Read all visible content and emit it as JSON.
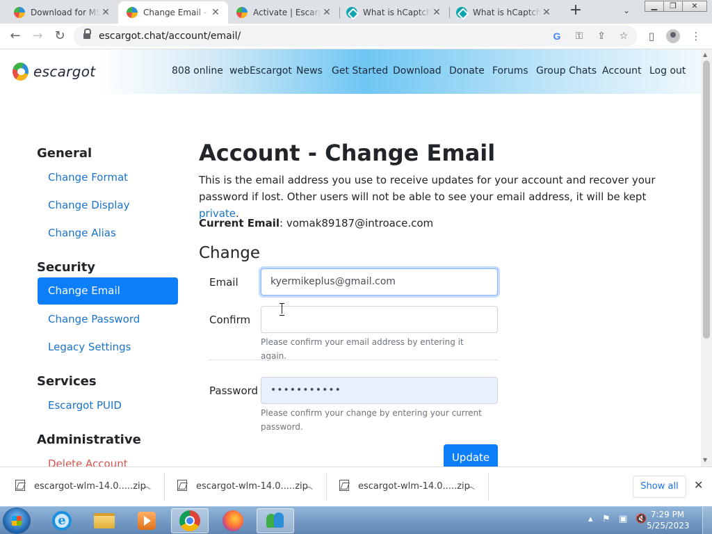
{
  "browser": {
    "tabs": [
      {
        "title": "Download for MSN",
        "active": false,
        "icon": "escargot-icon"
      },
      {
        "title": "Change Email - Acc",
        "active": true,
        "icon": "escargot-icon"
      },
      {
        "title": "Activate | Escargot",
        "active": false,
        "icon": "escargot-icon"
      },
      {
        "title": "What is hCaptcha",
        "active": false,
        "icon": "hcaptcha-icon"
      },
      {
        "title": "What is hCaptcha",
        "active": false,
        "icon": "hcaptcha-icon"
      }
    ],
    "url": "escargot.chat/account/email/"
  },
  "site": {
    "logo_text": "escargot",
    "nav": [
      "808 online",
      "webEscargot",
      "News",
      "Get Started",
      "Download",
      "Donate",
      "Forums",
      "Group Chats",
      "Account",
      "Log out"
    ]
  },
  "sidebar": {
    "sections": [
      {
        "heading": "General",
        "items": [
          "Change Format",
          "Change Display",
          "Change Alias"
        ]
      },
      {
        "heading": "Security",
        "items": [
          "Change Email",
          "Change Password",
          "Legacy Settings"
        ]
      },
      {
        "heading": "Services",
        "items": [
          "Escargot PUID"
        ]
      },
      {
        "heading": "Administrative",
        "items": [
          "Delete Account"
        ]
      }
    ],
    "active_item": "Change Email"
  },
  "main": {
    "title": "Account - Change Email",
    "description": "This is the email address you use to receive updates for your account and recover your password if lost. Other users will not be able to see your email address, it will be kept",
    "description_link": "private",
    "current_email_label": "Current Email",
    "current_email_value": "vomak89187@introace.com",
    "change_heading": "Change",
    "form": {
      "email_label": "Email",
      "email_value": "kyermikeplus@gmail.com",
      "confirm_label": "Confirm",
      "confirm_value": "",
      "confirm_hint": "Please confirm your email address by entering it again.",
      "password_label": "Password",
      "password_value": "•••••••••••",
      "password_hint": "Please confirm your change by entering your current password.",
      "submit_label": "Update"
    }
  },
  "downloads": {
    "items": [
      "escargot-wlm-14.0.....zip",
      "escargot-wlm-14.0.....zip",
      "escargot-wlm-14.0.....zip"
    ],
    "show_all_label": "Show all"
  },
  "taskbar": {
    "time": "7:29 PM",
    "date": "5/25/2023"
  },
  "colors": {
    "link": "#1a73c8",
    "primary": "#0d7ef9",
    "danger": "#d9534f"
  }
}
